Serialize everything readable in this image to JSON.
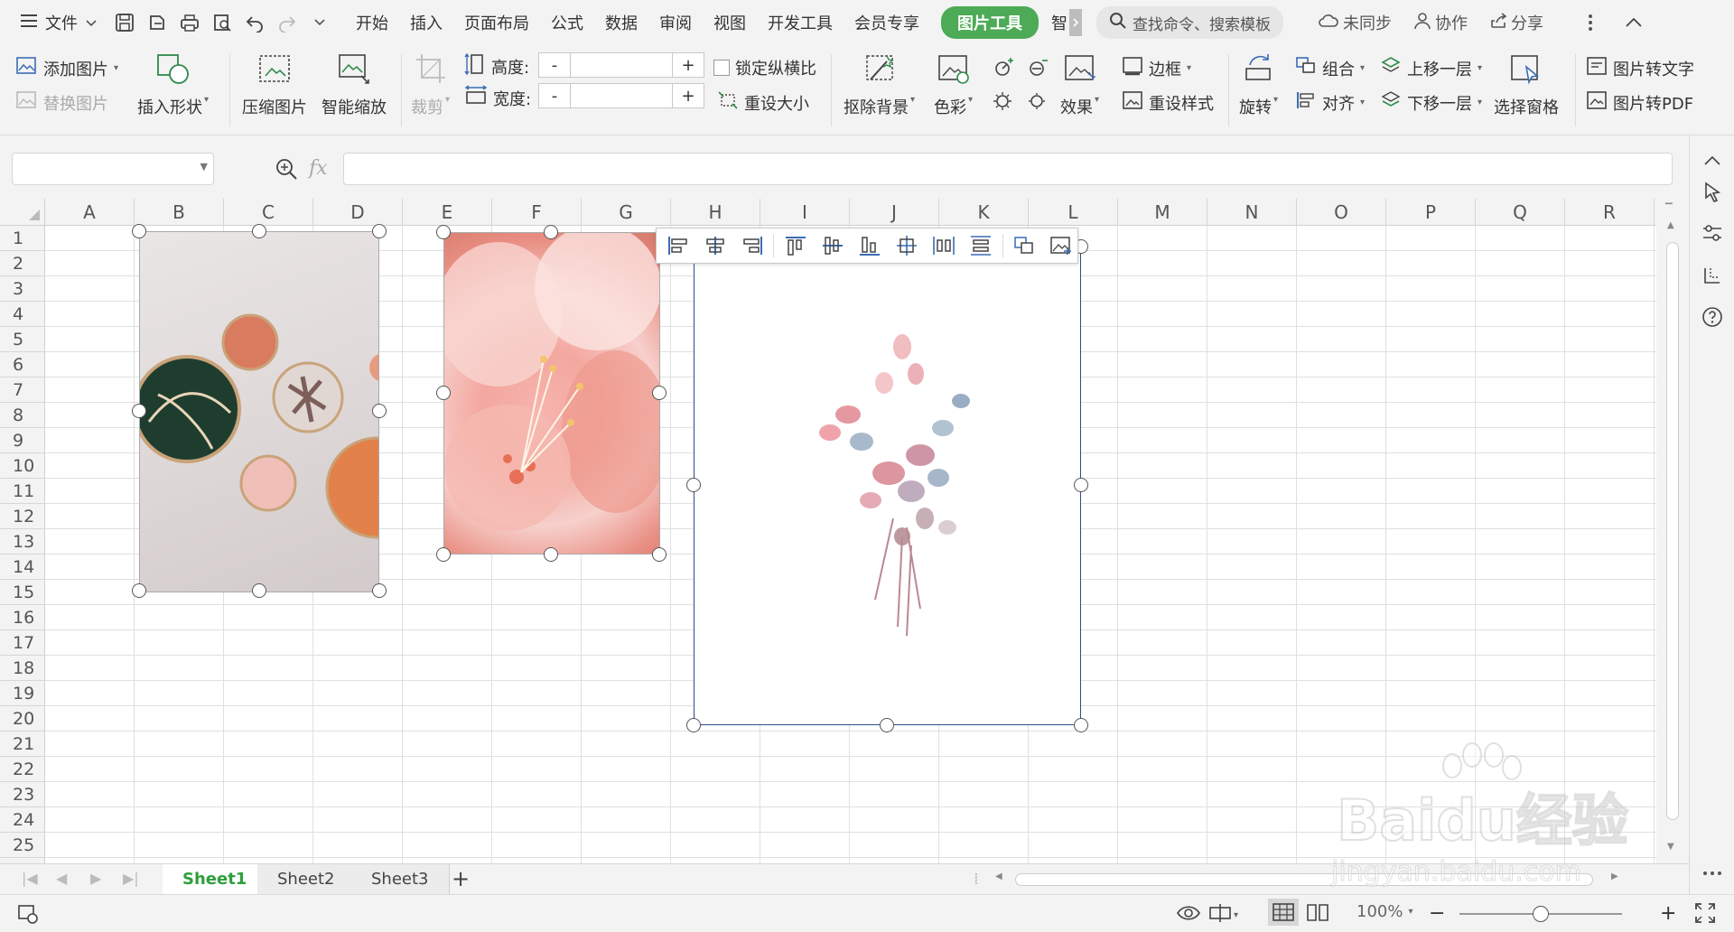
{
  "menubar": {
    "file_label": "文件",
    "tabs": [
      "开始",
      "插入",
      "页面布局",
      "公式",
      "数据",
      "审阅",
      "视图",
      "开发工具",
      "会员专享"
    ],
    "active_tab": "图片工具",
    "overflow_char": "智",
    "search_placeholder": "查找命令、搜索模板",
    "sync_label": "未同步",
    "collab_label": "协作",
    "share_label": "分享"
  },
  "ribbon": {
    "add_picture": "添加图片",
    "replace_picture": "替换图片",
    "insert_shape": "插入形状",
    "compress_picture": "压缩图片",
    "smart_scale": "智能缩放",
    "crop": "裁剪",
    "height_label": "高度:",
    "width_label": "宽度:",
    "minus": "-",
    "plus": "+",
    "lock_ratio": "锁定纵横比",
    "reset_size": "重设大小",
    "remove_bg": "抠除背景",
    "color": "色彩",
    "effect": "效果",
    "border": "边框",
    "reset_style": "重设样式",
    "rotate": "旋转",
    "group": "组合",
    "align": "对齐",
    "bring_forward": "上移一层",
    "send_backward": "下移一层",
    "selection_pane": "选择窗格",
    "pic_to_text": "图片转文字",
    "pic_to_pdf": "图片转PDF"
  },
  "formula": {
    "fx_label": "fx",
    "cell_ref": "",
    "content": ""
  },
  "columns": [
    "A",
    "B",
    "C",
    "D",
    "E",
    "F",
    "G",
    "H",
    "I",
    "J",
    "K",
    "L",
    "M",
    "N",
    "O",
    "P",
    "Q",
    "R"
  ],
  "rows": [
    "1",
    "2",
    "3",
    "4",
    "5",
    "6",
    "7",
    "8",
    "9",
    "10",
    "11",
    "12",
    "13",
    "14",
    "15",
    "16",
    "17",
    "18",
    "19",
    "20",
    "21",
    "22",
    "23",
    "24",
    "25"
  ],
  "sheets": [
    "Sheet1",
    "Sheet2",
    "Sheet3"
  ],
  "active_sheet": "Sheet1",
  "add_sheet": "+",
  "status": {
    "zoom": "100%",
    "zoom_minus": "−",
    "zoom_plus": "+",
    "zoom_level": 0.5
  },
  "watermark": {
    "brand": "Baidu经验",
    "url": "jingyan.baidu.com"
  },
  "colors": {
    "accent_green": "#4daa56",
    "active_sheet_text": "#2e9e3c",
    "selection_border": "#2c4e8a"
  }
}
